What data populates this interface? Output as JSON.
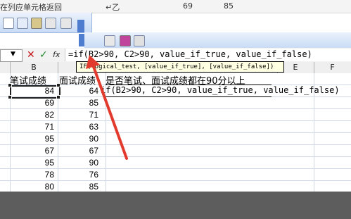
{
  "top_strip": {
    "text_left": "在列应单元格返回",
    "text_mid": "↵乙",
    "text_right1": "69",
    "text_right2": "85"
  },
  "formula_bar": {
    "cancel": "✕",
    "enter": "✓",
    "fx": "fx",
    "formula": "=if(B2>90, C2>90, value_if_true, value_if_false)"
  },
  "tooltip": "IF(logical_test, [value_if_true], [value_if_false])",
  "columns": [
    "B",
    "E",
    "F"
  ],
  "table": {
    "header_b": "笔试成绩",
    "header_c": "面试成绩",
    "header_d": "是否笔试、面试成绩都在90分以上",
    "d2_formula": "if(B2>90, C2>90, value_if_true, value_if_false)",
    "rows": [
      {
        "b": "84",
        "c": "64"
      },
      {
        "b": "69",
        "c": "85"
      },
      {
        "b": "82",
        "c": "71"
      },
      {
        "b": "71",
        "c": "63"
      },
      {
        "b": "95",
        "c": "90"
      },
      {
        "b": "67",
        "c": "67"
      },
      {
        "b": "95",
        "c": "90"
      },
      {
        "b": "78",
        "c": "76"
      },
      {
        "b": "80",
        "c": "85"
      }
    ]
  },
  "colors": {
    "arrow": "#e23b2e",
    "toolbar_blue": "#c9dcf5",
    "cancel": "#c4171b",
    "enter": "#1f8a2b"
  },
  "icons": [
    "cut-icon",
    "copy-icon",
    "format-painter-icon",
    "undo-icon",
    "link-icon",
    "chart-icon",
    "font-color-icon"
  ]
}
